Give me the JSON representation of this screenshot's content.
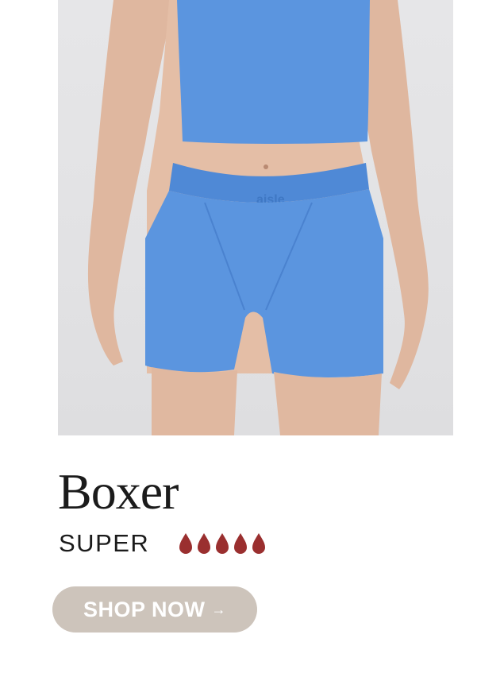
{
  "product": {
    "name": "Boxer",
    "absorbency_label": "SUPER",
    "absorbency_level": 5,
    "absorbency_max": 5,
    "drop_color": "#9a2f2f",
    "garment_color": "#5b95df",
    "waistband_text": "aisle"
  },
  "cta": {
    "label": "SHOP NOW",
    "arrow_icon": "→",
    "bg_color": "#cdc4bb"
  }
}
